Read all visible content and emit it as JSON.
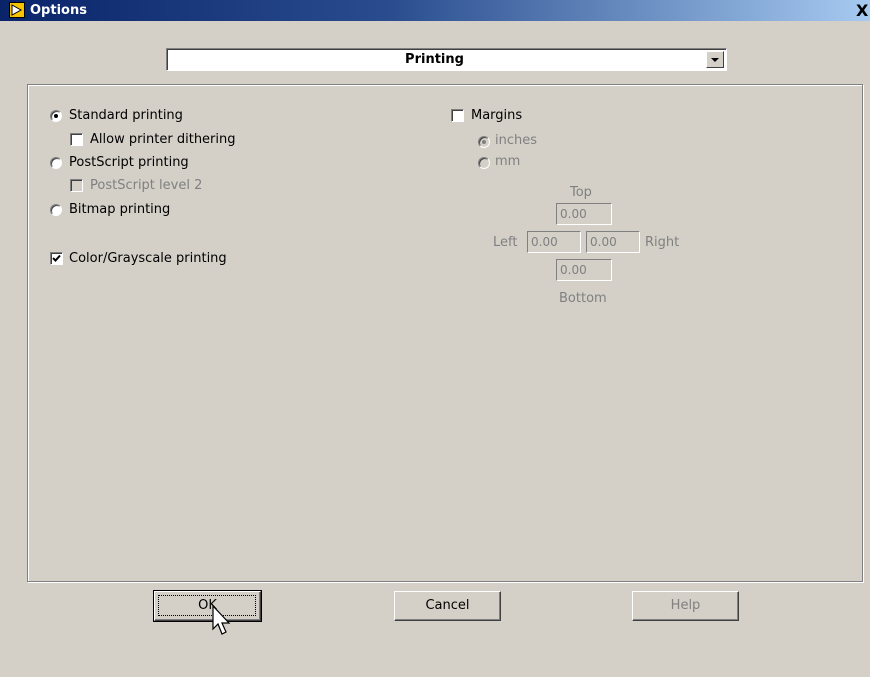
{
  "window": {
    "title": "Options",
    "close_label": "X"
  },
  "category_select": {
    "value": "Printing"
  },
  "printing": {
    "standard_label": "Standard printing",
    "dithering_label": "Allow printer dithering",
    "postscript_label": "PostScript printing",
    "postscript_level2_label": "PostScript level 2",
    "bitmap_label": "Bitmap printing",
    "color_label": "Color/Grayscale printing"
  },
  "margins": {
    "label": "Margins",
    "inches_label": "inches",
    "mm_label": "mm",
    "top_label": "Top",
    "left_label": "Left",
    "right_label": "Right",
    "bottom_label": "Bottom",
    "top_value": "0.00",
    "left_value": "0.00",
    "right_value": "0.00",
    "bottom_value": "0.00"
  },
  "buttons": {
    "ok": "OK",
    "cancel": "Cancel",
    "help": "Help"
  }
}
